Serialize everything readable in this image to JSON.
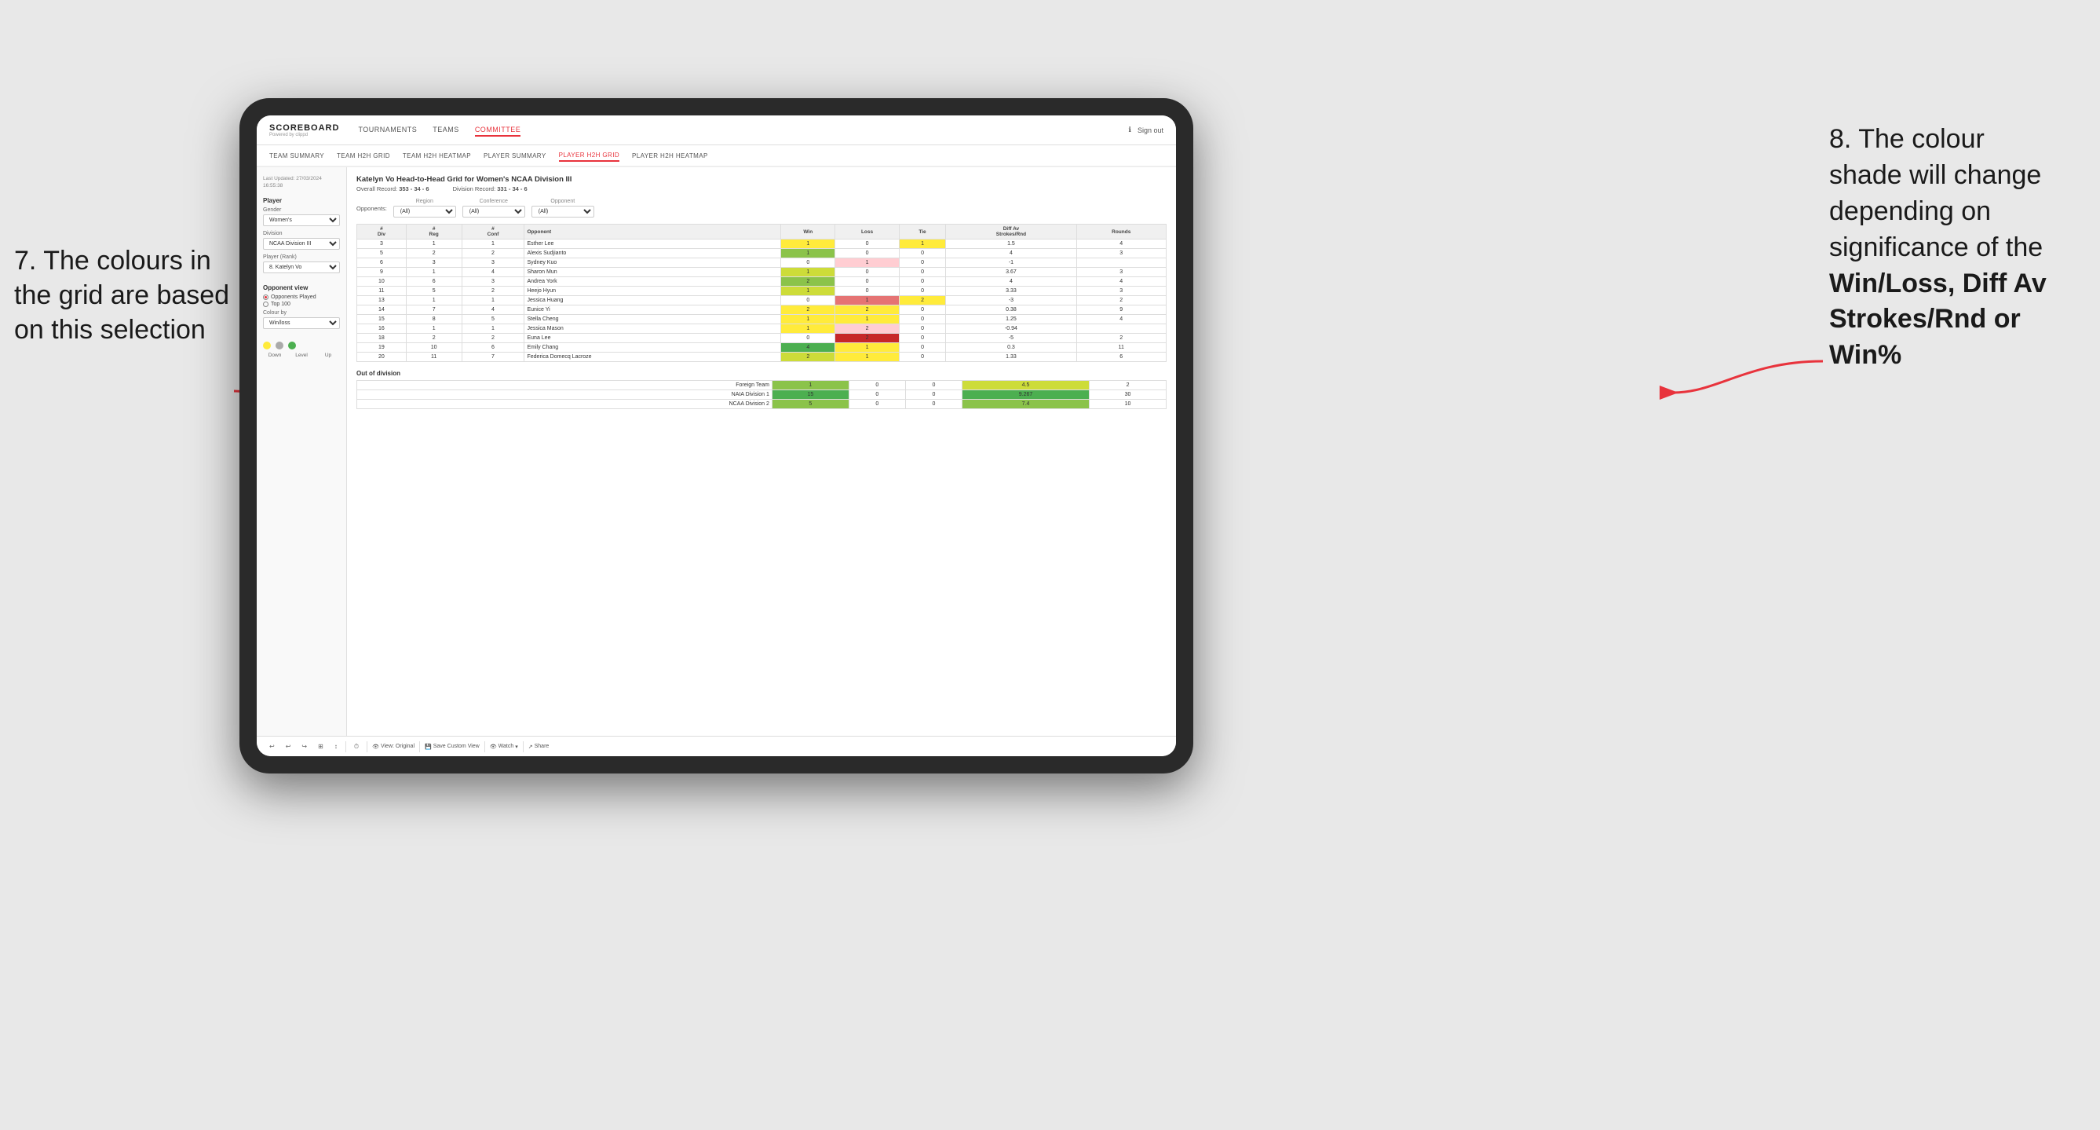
{
  "annotations": {
    "left_text_1": "7. The colours in",
    "left_text_2": "the grid are based",
    "left_text_3": "on this selection",
    "right_text_1": "8. The colour",
    "right_text_2": "shade will change",
    "right_text_3": "depending on",
    "right_text_4": "significance of the",
    "right_bold_1": "Win/Loss",
    "right_bold_2": ", Diff Av",
    "right_bold_3": "Strokes/Rnd",
    "right_bold_4": " or",
    "right_bold_5": "Win%"
  },
  "nav": {
    "logo": "SCOREBOARD",
    "logo_sub": "Powered by clippd",
    "links": [
      "TOURNAMENTS",
      "TEAMS",
      "COMMITTEE"
    ],
    "active_link": "COMMITTEE",
    "sign_out": "Sign out"
  },
  "sub_nav": {
    "links": [
      "TEAM SUMMARY",
      "TEAM H2H GRID",
      "TEAM H2H HEATMAP",
      "PLAYER SUMMARY",
      "PLAYER H2H GRID",
      "PLAYER H2H HEATMAP"
    ],
    "active": "PLAYER H2H GRID"
  },
  "sidebar": {
    "timestamp_label": "Last Updated: 27/03/2024",
    "timestamp_time": "16:55:38",
    "player_section": "Player",
    "gender_label": "Gender",
    "gender_value": "Women's",
    "division_label": "Division",
    "division_value": "NCAA Division III",
    "player_rank_label": "Player (Rank)",
    "player_rank_value": "8. Katelyn Vo",
    "opponent_view_label": "Opponent view",
    "opponent_played": "Opponents Played",
    "top_100": "Top 100",
    "colour_by_label": "Colour by",
    "colour_by_value": "Win/loss",
    "legend_down": "Down",
    "legend_level": "Level",
    "legend_up": "Up"
  },
  "grid": {
    "title": "Katelyn Vo Head-to-Head Grid for Women's NCAA Division III",
    "overall_record_label": "Overall Record:",
    "overall_record_value": "353 - 34 - 6",
    "division_record_label": "Division Record:",
    "division_record_value": "331 - 34 - 6",
    "opponents_label": "Opponents:",
    "opponents_value": "(All)",
    "region_label": "Region",
    "region_value": "(All)",
    "conference_label": "Conference",
    "conference_value": "(All)",
    "opponent_label": "Opponent",
    "opponent_value": "(All)",
    "columns": [
      "#\nDiv",
      "#\nReg",
      "#\nConf",
      "Opponent",
      "Win",
      "Loss",
      "Tie",
      "Diff Av\nStrokes/Rnd",
      "Rounds"
    ],
    "rows": [
      {
        "div": "3",
        "reg": "1",
        "conf": "1",
        "name": "Esther Lee",
        "win": 1,
        "loss": 0,
        "tie": 1,
        "diff": 1.5,
        "rounds": 4,
        "win_color": "yellow",
        "loss_color": "plain",
        "tie_color": "yellow"
      },
      {
        "div": "5",
        "reg": "2",
        "conf": "2",
        "name": "Alexis Sudjianto",
        "win": 1,
        "loss": 0,
        "tie": 0,
        "diff": 4.0,
        "rounds": 3,
        "win_color": "green-med",
        "loss_color": "plain",
        "tie_color": "plain"
      },
      {
        "div": "6",
        "reg": "3",
        "conf": "3",
        "name": "Sydney Kuo",
        "win": 0,
        "loss": 1,
        "tie": 0,
        "diff": -1.0,
        "rounds": "",
        "win_color": "plain",
        "loss_color": "red-light",
        "tie_color": "plain"
      },
      {
        "div": "9",
        "reg": "1",
        "conf": "4",
        "name": "Sharon Mun",
        "win": 1,
        "loss": 0,
        "tie": 0,
        "diff": 3.67,
        "rounds": 3,
        "win_color": "green-light",
        "loss_color": "plain",
        "tie_color": "plain"
      },
      {
        "div": "10",
        "reg": "6",
        "conf": "3",
        "name": "Andrea York",
        "win": 2,
        "loss": 0,
        "tie": 0,
        "diff": 4.0,
        "rounds": 4,
        "win_color": "green-med",
        "loss_color": "plain",
        "tie_color": "plain"
      },
      {
        "div": "11",
        "reg": "5",
        "conf": "2",
        "name": "Heejo Hyun",
        "win": 1,
        "loss": 0,
        "tie": 0,
        "diff": 3.33,
        "rounds": 3,
        "win_color": "green-light",
        "loss_color": "plain",
        "tie_color": "plain"
      },
      {
        "div": "13",
        "reg": "1",
        "conf": "1",
        "name": "Jessica Huang",
        "win": 0,
        "loss": 1,
        "tie": 2,
        "diff": -3.0,
        "rounds": 2,
        "win_color": "plain",
        "loss_color": "red-med",
        "tie_color": "yellow"
      },
      {
        "div": "14",
        "reg": "7",
        "conf": "4",
        "name": "Eunice Yi",
        "win": 2,
        "loss": 2,
        "tie": 0,
        "diff": 0.38,
        "rounds": 9,
        "win_color": "yellow",
        "loss_color": "yellow",
        "tie_color": "plain"
      },
      {
        "div": "15",
        "reg": "8",
        "conf": "5",
        "name": "Stella Cheng",
        "win": 1,
        "loss": 1,
        "tie": 0,
        "diff": 1.25,
        "rounds": 4,
        "win_color": "yellow",
        "loss_color": "yellow",
        "tie_color": "plain"
      },
      {
        "div": "16",
        "reg": "1",
        "conf": "1",
        "name": "Jessica Mason",
        "win": 1,
        "loss": 2,
        "tie": 0,
        "diff": -0.94,
        "rounds": "",
        "win_color": "yellow",
        "loss_color": "red-light",
        "tie_color": "plain"
      },
      {
        "div": "18",
        "reg": "2",
        "conf": "2",
        "name": "Euna Lee",
        "win": 0,
        "loss": 2,
        "tie": 0,
        "diff": -5.0,
        "rounds": 2,
        "win_color": "plain",
        "loss_color": "red-dark",
        "tie_color": "plain"
      },
      {
        "div": "19",
        "reg": "10",
        "conf": "6",
        "name": "Emily Chang",
        "win": 4,
        "loss": 1,
        "tie": 0,
        "diff": 0.3,
        "rounds": 11,
        "win_color": "green-dark",
        "loss_color": "yellow",
        "tie_color": "plain"
      },
      {
        "div": "20",
        "reg": "11",
        "conf": "7",
        "name": "Federica Domecq Lacroze",
        "win": 2,
        "loss": 1,
        "tie": 0,
        "diff": 1.33,
        "rounds": 6,
        "win_color": "green-light",
        "loss_color": "yellow",
        "tie_color": "plain"
      }
    ],
    "out_of_division_label": "Out of division",
    "out_of_division_rows": [
      {
        "name": "Foreign Team",
        "win": 1,
        "loss": 0,
        "tie": 0,
        "diff": 4.5,
        "rounds": 2,
        "win_color": "green-med",
        "diff_color": "green-light"
      },
      {
        "name": "NAIA Division 1",
        "win": 15,
        "loss": 0,
        "tie": 0,
        "diff": 9.267,
        "rounds": 30,
        "win_color": "green-dark",
        "diff_color": "green-dark"
      },
      {
        "name": "NCAA Division 2",
        "win": 5,
        "loss": 0,
        "tie": 0,
        "diff": 7.4,
        "rounds": 10,
        "win_color": "green-med",
        "diff_color": "green-med"
      }
    ]
  },
  "toolbar": {
    "view_original": "View: Original",
    "save_custom": "Save Custom View",
    "watch": "Watch",
    "share": "Share"
  },
  "colors": {
    "accent": "#e8333c",
    "green_dark": "#4caf50",
    "green_med": "#8bc34a",
    "green_light": "#cddc39",
    "yellow": "#ffeb3b",
    "red_light": "#ffcdd2",
    "red_med": "#ef9a9a",
    "red_dark": "#e57373"
  }
}
